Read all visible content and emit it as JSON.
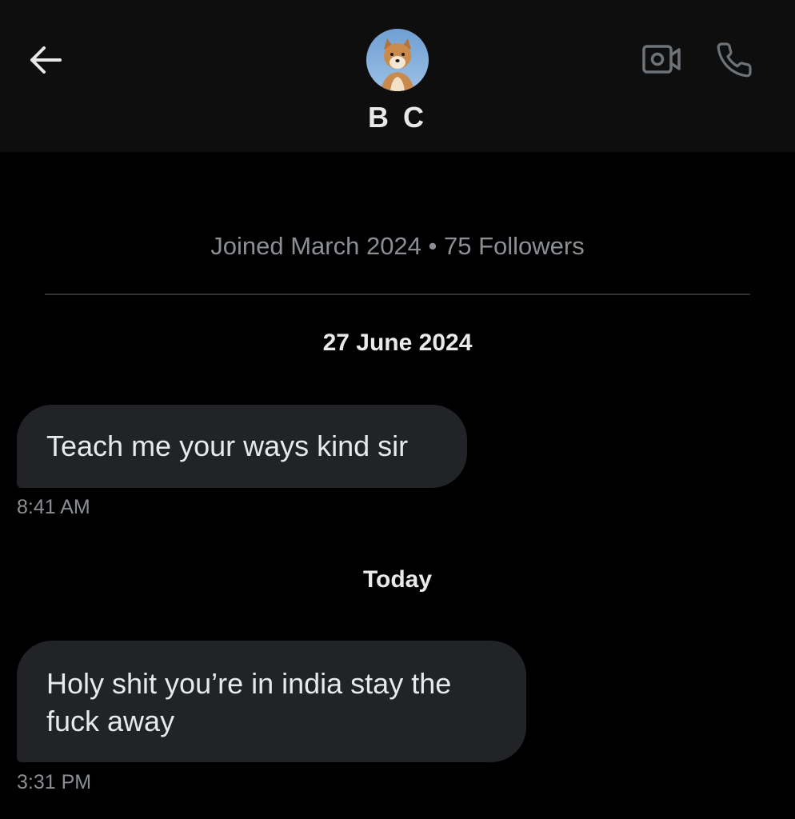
{
  "header": {
    "contact_name": "B C",
    "icons": {
      "back": "arrow-left-icon",
      "video": "video-camera-icon",
      "call": "phone-icon",
      "avatar": "shiba-dog-avatar"
    }
  },
  "profile": {
    "meta": "Joined March 2024 • 75 Followers"
  },
  "conversation": {
    "sections": [
      {
        "date_label": "27 June 2024",
        "messages": [
          {
            "text": "Teach me your ways kind sir",
            "time": "8:41 AM"
          }
        ]
      },
      {
        "date_label": "Today",
        "messages": [
          {
            "text": "Holy shit you’re in india stay the fuck away",
            "time": "3:31 PM"
          }
        ]
      }
    ]
  },
  "colors": {
    "background": "#000000",
    "header_bg": "#0e0e0e",
    "bubble_bg": "#212327",
    "primary_text": "#e7e9ea",
    "secondary_text": "#8b8f94",
    "divider": "#2f3336"
  }
}
